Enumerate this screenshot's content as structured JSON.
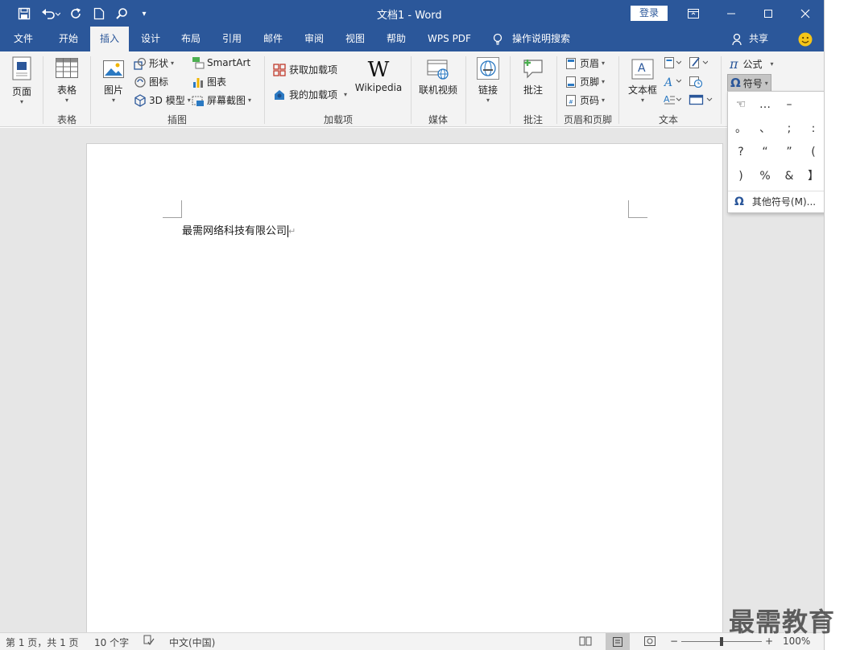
{
  "window": {
    "title": "文档1  -  Word",
    "login_label": "登录"
  },
  "tabs": [
    "文件",
    "开始",
    "插入",
    "设计",
    "布局",
    "引用",
    "邮件",
    "审阅",
    "视图",
    "帮助",
    "WPS PDF",
    "操作说明搜索"
  ],
  "share_label": "共享",
  "ribbon": {
    "pages": {
      "label": "页面",
      "group": ""
    },
    "table": {
      "label": "表格",
      "group": "表格"
    },
    "illustrations": {
      "picture": "图片",
      "shapes": "形状",
      "icons": "图标",
      "model3d": "3D 模型",
      "smartart": "SmartArt",
      "chart": "图表",
      "screenshot": "屏幕截图",
      "group": "插图"
    },
    "addins": {
      "get": "获取加载项",
      "mine": "我的加载项",
      "wikipedia": "Wikipedia",
      "group": "加载项"
    },
    "media": {
      "video": "联机视频",
      "group": "媒体"
    },
    "links": {
      "link": "链接"
    },
    "comments": {
      "comment": "批注",
      "group": "批注"
    },
    "header_footer": {
      "header": "页眉",
      "footer": "页脚",
      "page_number": "页码",
      "group": "页眉和页脚"
    },
    "text": {
      "textbox": "文本框",
      "group": "文本"
    },
    "symbols": {
      "equation": "公式",
      "symbol": "符号"
    }
  },
  "symbol_panel": {
    "symbols": [
      "☜",
      "…",
      "–",
      "",
      ",",
      "。",
      "、",
      ";",
      ":",
      "!",
      "?",
      "“",
      "”",
      "(",
      "【",
      ")",
      "%",
      "&",
      "】",
      "※"
    ],
    "more_label": "其他符号(M)..."
  },
  "document": {
    "text": "最需网络科技有限公司"
  },
  "status": {
    "page": "第 1 页，共 1 页",
    "words": "10 个字",
    "language": "中文(中国)",
    "zoom": "100%"
  },
  "watermark": "最需教育",
  "colors": {
    "accent": "#2b579a",
    "ribbon_bg": "#f3f3f3",
    "canvas_bg": "#e6e6e6"
  }
}
